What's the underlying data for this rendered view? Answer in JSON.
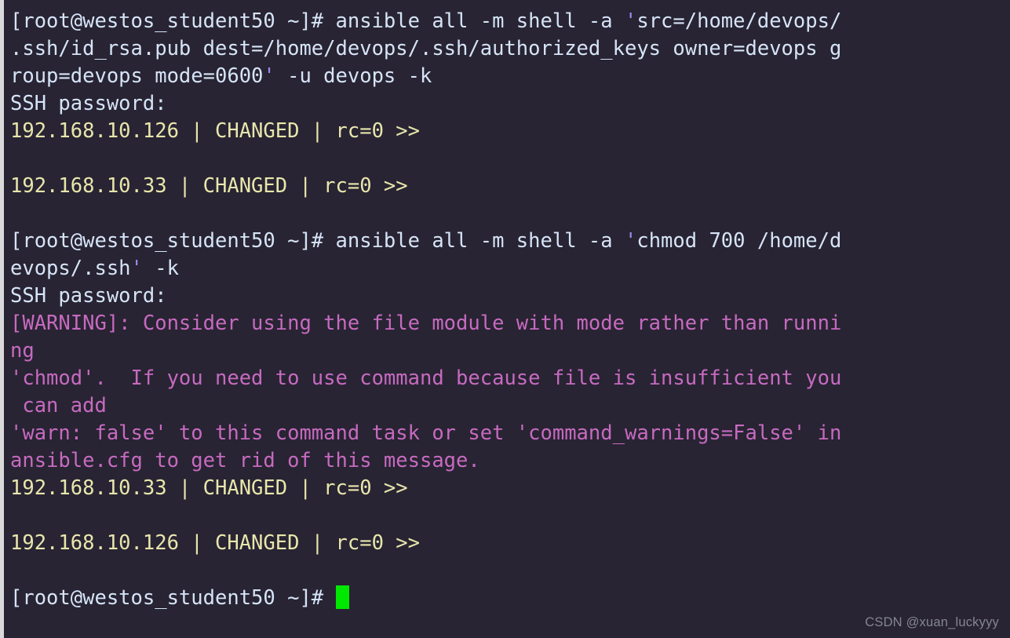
{
  "window": {
    "title": "root@westos_student50:~",
    "background_color": "#282433",
    "gutter_color": "#d9d9d9"
  },
  "colors": {
    "default_text": "#d6e4f7",
    "prompt_text": "#d6e4f7",
    "quote": "#9b8cf0",
    "host_result": "#e8e6ac",
    "warning": "#c76ac0",
    "cursor": "#00e800",
    "watermark": "#8b8b99"
  },
  "terminal": {
    "prompt": "[root@westos_student50 ~]# ",
    "lines": [
      {
        "kind": "command",
        "segments": [
          {
            "text": "[root@westos_student50 ~]# ",
            "color": "prompt"
          },
          {
            "text": "ansible all -m shell -a ",
            "color": "default"
          },
          {
            "text": "'",
            "color": "quote"
          },
          {
            "text": "src=/home/devops/",
            "color": "default"
          }
        ]
      },
      {
        "kind": "wrap",
        "segments": [
          {
            "text": ".ssh/id_rsa.pub dest=/home/devops/.ssh/authorized_keys owner=devops g",
            "color": "default"
          }
        ]
      },
      {
        "kind": "wrap",
        "segments": [
          {
            "text": "roup=devops mode=0600",
            "color": "default"
          },
          {
            "text": "'",
            "color": "quote"
          },
          {
            "text": " -u devops -k",
            "color": "default"
          }
        ]
      },
      {
        "kind": "output",
        "segments": [
          {
            "text": "SSH password:",
            "color": "default"
          }
        ]
      },
      {
        "kind": "output",
        "segments": [
          {
            "text": "192.168.10.126 | CHANGED | rc=0 >>",
            "color": "host_result"
          }
        ]
      },
      {
        "kind": "blank",
        "segments": []
      },
      {
        "kind": "output",
        "segments": [
          {
            "text": "192.168.10.33 | CHANGED | rc=0 >>",
            "color": "host_result"
          }
        ]
      },
      {
        "kind": "blank",
        "segments": []
      },
      {
        "kind": "command",
        "segments": [
          {
            "text": "[root@westos_student50 ~]# ",
            "color": "prompt"
          },
          {
            "text": "ansible all -m shell -a ",
            "color": "default"
          },
          {
            "text": "'",
            "color": "quote"
          },
          {
            "text": "chmod 700 /home/d",
            "color": "default"
          }
        ]
      },
      {
        "kind": "wrap",
        "segments": [
          {
            "text": "evops/.ssh",
            "color": "default"
          },
          {
            "text": "'",
            "color": "quote"
          },
          {
            "text": " -k",
            "color": "default"
          }
        ]
      },
      {
        "kind": "output",
        "segments": [
          {
            "text": "SSH password:",
            "color": "default"
          }
        ]
      },
      {
        "kind": "output",
        "segments": [
          {
            "text": "[WARNING]: Consider using the file module with mode rather than runni",
            "color": "warning"
          }
        ]
      },
      {
        "kind": "output",
        "segments": [
          {
            "text": "ng",
            "color": "warning"
          }
        ]
      },
      {
        "kind": "output",
        "segments": [
          {
            "text": "'chmod'.  If you need to use command because file is insufficient you",
            "color": "warning"
          }
        ]
      },
      {
        "kind": "output",
        "segments": [
          {
            "text": " can add",
            "color": "warning"
          }
        ]
      },
      {
        "kind": "output",
        "segments": [
          {
            "text": "'warn: false' to this command task or set 'command_warnings=False' in",
            "color": "warning"
          }
        ]
      },
      {
        "kind": "output",
        "segments": [
          {
            "text": "ansible.cfg to get rid of this message.",
            "color": "warning"
          }
        ]
      },
      {
        "kind": "output",
        "segments": [
          {
            "text": "192.168.10.33 | CHANGED | rc=0 >>",
            "color": "host_result"
          }
        ]
      },
      {
        "kind": "blank",
        "segments": []
      },
      {
        "kind": "output",
        "segments": [
          {
            "text": "192.168.10.126 | CHANGED | rc=0 >>",
            "color": "host_result"
          }
        ]
      },
      {
        "kind": "blank",
        "segments": []
      },
      {
        "kind": "prompt-cursor",
        "segments": [
          {
            "text": "[root@westos_student50 ~]# ",
            "color": "prompt"
          }
        ],
        "cursor": true
      }
    ]
  },
  "watermark": {
    "text": "CSDN @xuan_luckyyy"
  }
}
